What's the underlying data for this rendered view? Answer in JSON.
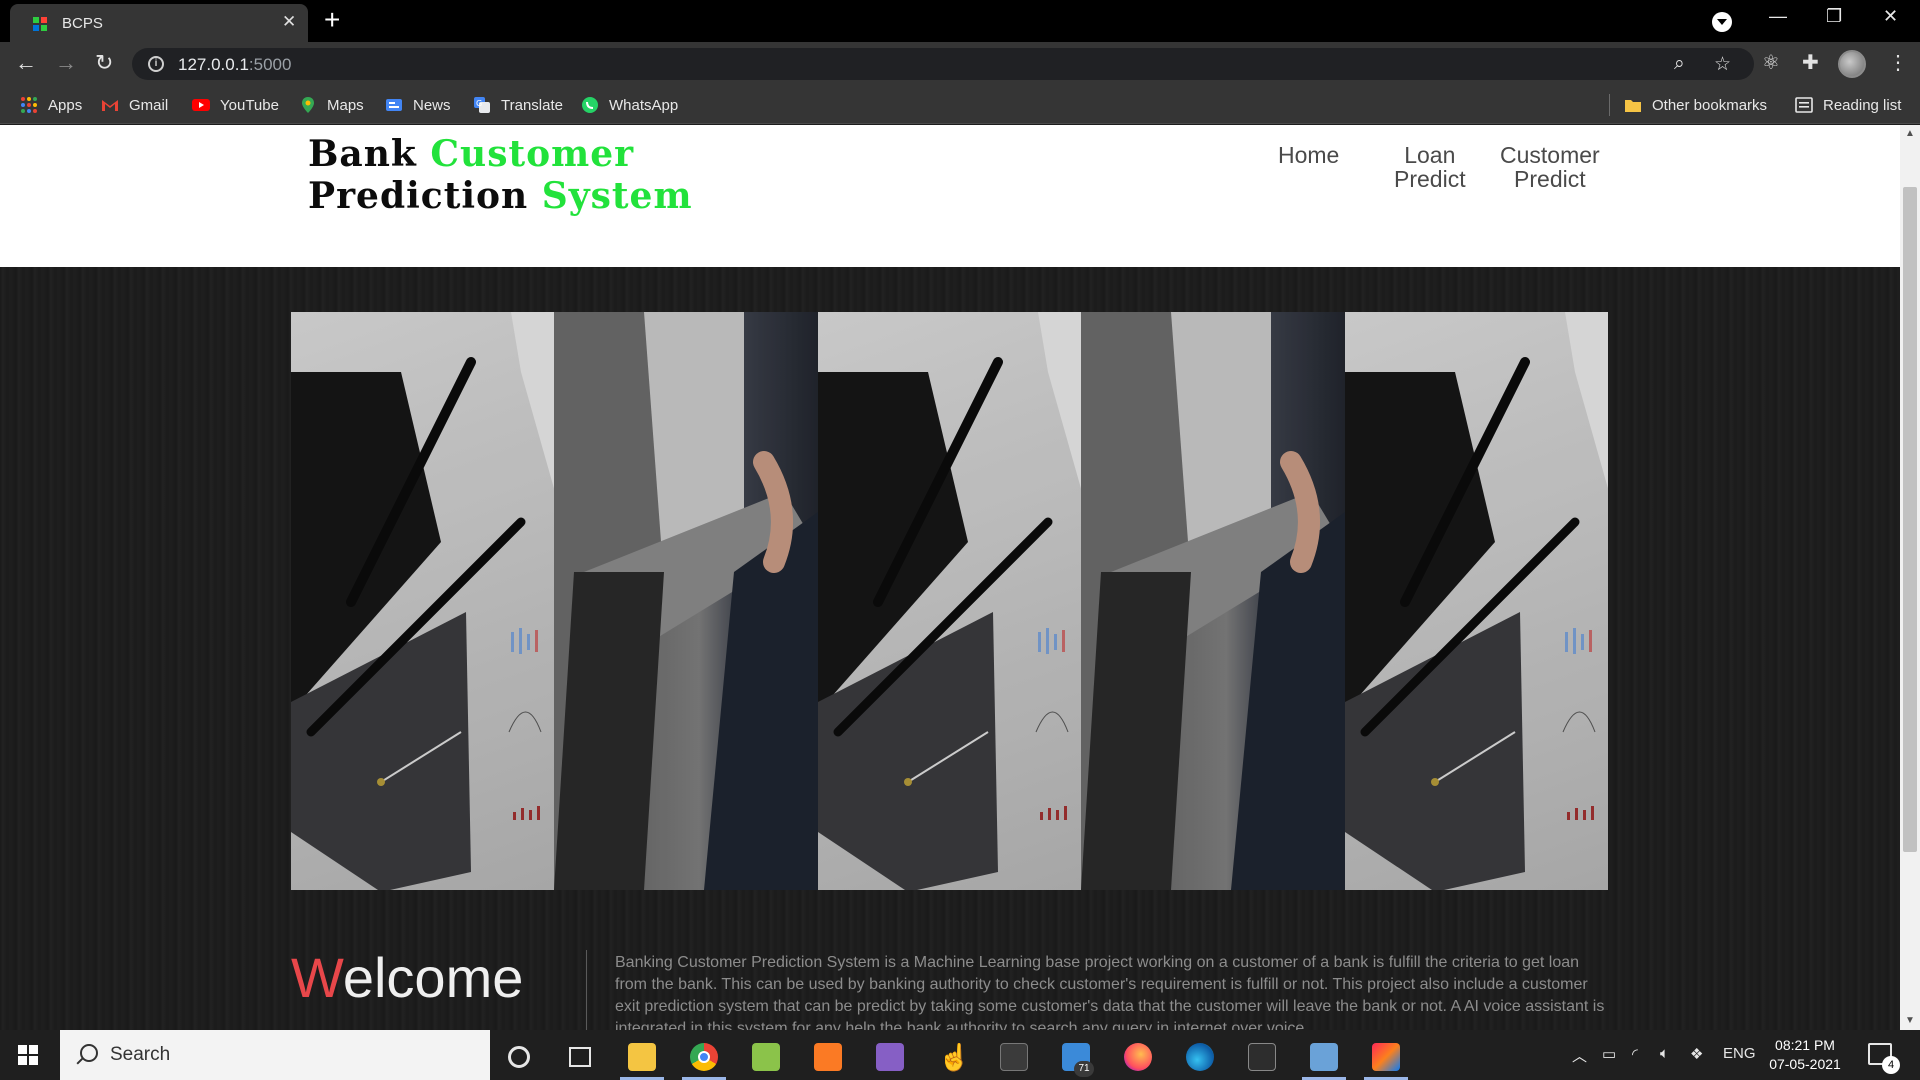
{
  "browser": {
    "tab_title": "BCPS",
    "url_host": "127.0.0.1",
    "url_port": ":5000",
    "bookmarks": [
      "Apps",
      "Gmail",
      "YouTube",
      "Maps",
      "News",
      "Translate",
      "WhatsApp"
    ],
    "other_bookmarks": "Other bookmarks",
    "reading_list": "Reading list"
  },
  "site": {
    "logo_line1_a": "Bank ",
    "logo_line1_b": "Customer",
    "logo_line2_a": "Prediction ",
    "logo_line2_b": "System",
    "nav": {
      "home": "Home",
      "loan_1": "Loan",
      "loan_2": "Predict",
      "customer_1": "Customer",
      "customer_2": "Predict"
    },
    "welcome_first": "W",
    "welcome_rest": "elcome",
    "intro": "Banking Customer Prediction System is a Machine Learning base project working on a customer of a bank is fulfill the criteria to get loan from the bank. This can be used by banking authority to check customer's requirement is fulfill or not. This project also include a customer exit prediction system that can be predict by taking some customer's data that the customer will leave the bank or not. A AI voice assistant is integrated in this system for any help the bank authority to search any query in internet over voice."
  },
  "taskbar": {
    "search_placeholder": "Search",
    "mail_badge": "71",
    "lang": "ENG",
    "time": "08:21 PM",
    "date": "07-05-2021",
    "notifications": "4"
  }
}
